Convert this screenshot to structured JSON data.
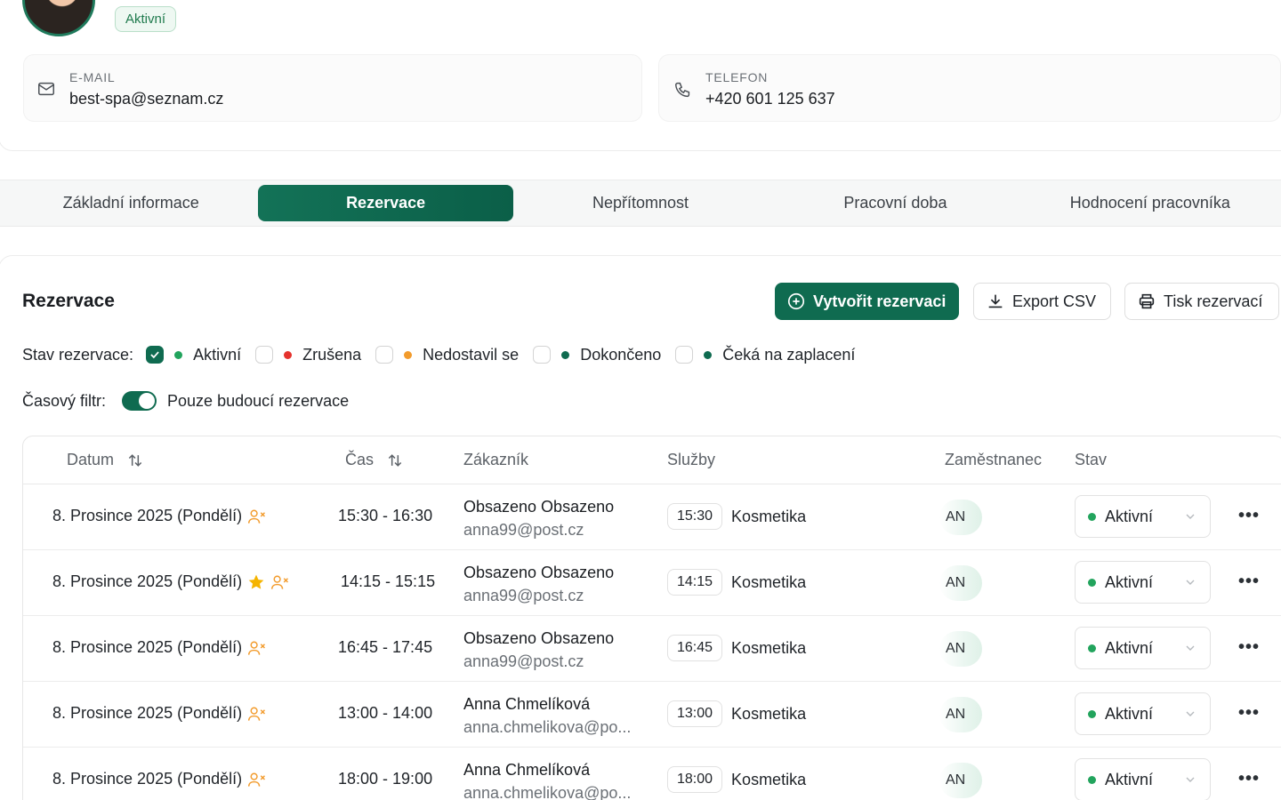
{
  "profile": {
    "status": "Aktivní",
    "email_label": "E-MAIL",
    "email_value": "best-spa@seznam.cz",
    "phone_label": "TELEFON",
    "phone_value": "+420 601 125 637"
  },
  "tabs": [
    {
      "label": "Základní informace",
      "active": false
    },
    {
      "label": "Rezervace",
      "active": true
    },
    {
      "label": "Nepřítomnost",
      "active": false
    },
    {
      "label": "Pracovní doba",
      "active": false
    },
    {
      "label": "Hodnocení pracovníka",
      "active": false
    }
  ],
  "section": {
    "title": "Rezervace",
    "create_label": "Vytvořit rezervaci",
    "export_label": "Export CSV",
    "print_label": "Tisk rezervací"
  },
  "filters": {
    "status_label": "Stav rezervace:",
    "options": [
      {
        "label": "Aktivní",
        "checked": true,
        "color": "#22a45d"
      },
      {
        "label": "Zrušena",
        "checked": false,
        "color": "#e5322d"
      },
      {
        "label": "Nedostavil se",
        "checked": false,
        "color": "#f29b2c"
      },
      {
        "label": "Dokončeno",
        "checked": false,
        "color": "#0f6b50"
      },
      {
        "label": "Čeká na zaplacení",
        "checked": false,
        "color": "#0f6b50"
      }
    ],
    "time_label": "Časový filtr:",
    "time_toggle_label": "Pouze budoucí rezervace",
    "time_toggle_on": true
  },
  "table": {
    "headers": {
      "date": "Datum",
      "time": "Čas",
      "customer": "Zákazník",
      "services": "Služby",
      "employee": "Zaměstnanec",
      "state": "Stav"
    },
    "rows": [
      {
        "date": "8. Prosince 2025 (Pondělí)",
        "star": false,
        "time": "15:30 - 16:30",
        "name": "Obsazeno Obsazeno",
        "email": "anna99@post.cz",
        "chip": "15:30",
        "service": "Kosmetika",
        "employee": "AN",
        "state": "Aktivní"
      },
      {
        "date": "8. Prosince 2025 (Pondělí)",
        "star": true,
        "time": "14:15 - 15:15",
        "name": "Obsazeno Obsazeno",
        "email": "anna99@post.cz",
        "chip": "14:15",
        "service": "Kosmetika",
        "employee": "AN",
        "state": "Aktivní"
      },
      {
        "date": "8. Prosince 2025 (Pondělí)",
        "star": false,
        "time": "16:45 - 17:45",
        "name": "Obsazeno Obsazeno",
        "email": "anna99@post.cz",
        "chip": "16:45",
        "service": "Kosmetika",
        "employee": "AN",
        "state": "Aktivní"
      },
      {
        "date": "8. Prosince 2025 (Pondělí)",
        "star": false,
        "time": "13:00 - 14:00",
        "name": "Anna Chmelíková",
        "email": "anna.chmelikova@po...",
        "chip": "13:00",
        "service": "Kosmetika",
        "employee": "AN",
        "state": "Aktivní"
      },
      {
        "date": "8. Prosince 2025 (Pondělí)",
        "star": false,
        "time": "18:00 - 19:00",
        "name": "Anna Chmelíková",
        "email": "anna.chmelikova@po...",
        "chip": "18:00",
        "service": "Kosmetika",
        "employee": "AN",
        "state": "Aktivní"
      }
    ],
    "state_dot_color": "#22a45d",
    "row_menu": "•••"
  },
  "colors": {
    "brand": "#0f6b50",
    "warning_icon": "#f29b2c",
    "star": "#f5b400"
  }
}
